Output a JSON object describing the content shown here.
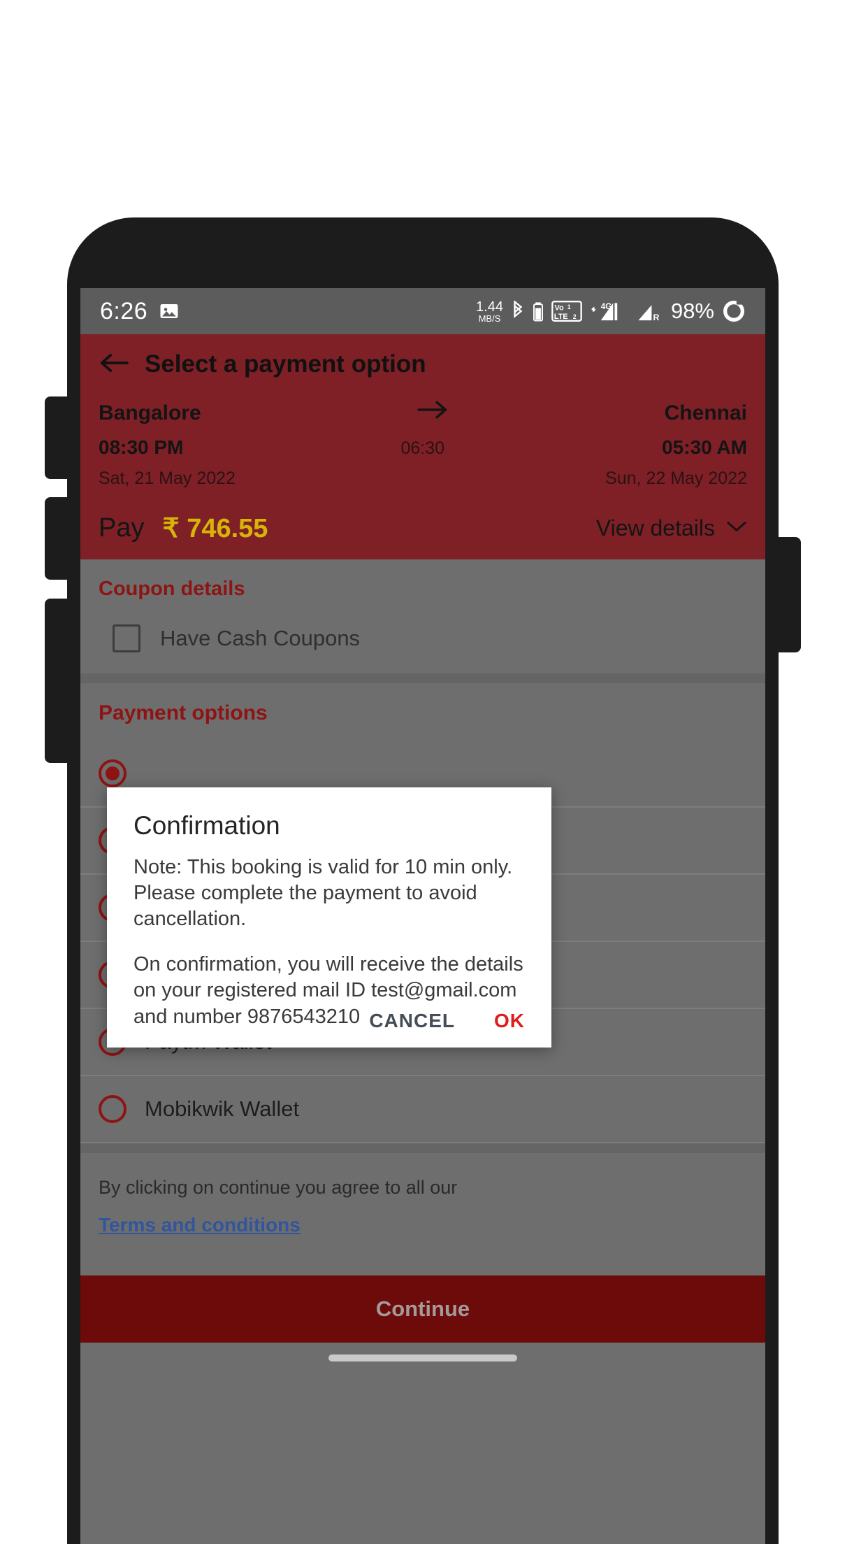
{
  "status_bar": {
    "time": "6:26",
    "screenshot_icon": "image-icon",
    "data_speed_value": "1.44",
    "data_speed_unit": "MB/S",
    "bluetooth_icon": "bluetooth-icon",
    "bluetooth_battery_icon": "bluetooth-battery-icon",
    "volte_icon": "volte-icon",
    "volte_label_top": "Vo",
    "volte_label_bottom": "LTE",
    "sim1_label": "1",
    "sim2_label": "2",
    "network_type": "4G",
    "signal1_icon": "signal-bars-icon",
    "signal2_icon": "signal-bars-roaming-icon",
    "roaming_label": "R",
    "battery_percent": "98%",
    "battery_icon": "battery-ring-icon"
  },
  "header": {
    "back_icon": "arrow-left-icon",
    "title": "Select a payment option",
    "from_city": "Bangalore",
    "to_city": "Chennai",
    "arrow_icon": "arrow-right-icon",
    "depart_time": "08:30 PM",
    "duration": "06:30",
    "arrive_time": "05:30 AM",
    "depart_date": "Sat, 21 May 2022",
    "arrive_date": "Sun, 22 May 2022",
    "pay_label": "Pay",
    "pay_amount": "₹ 746.55",
    "view_details_label": "View details",
    "view_details_icon": "chevron-down-icon",
    "bg_color": "#7e2026",
    "amount_color": "#d6b40a"
  },
  "coupon": {
    "title": "Coupon details",
    "checkbox_label": "Have Cash Coupons",
    "checked": false,
    "title_color": "#8e1414"
  },
  "payment": {
    "title": "Payment options",
    "options": [
      {
        "label": "",
        "selected": true
      },
      {
        "label": "",
        "selected": false
      },
      {
        "label": "",
        "selected": false
      },
      {
        "label": "",
        "selected": false
      },
      {
        "label": "Paytm Wallet",
        "selected": false
      },
      {
        "label": "Mobikwik Wallet",
        "selected": false
      }
    ],
    "accent_color": "#8e1414"
  },
  "terms": {
    "text": "By clicking on continue you agree to all our",
    "link": "Terms and conditions",
    "link_color": "#31569c"
  },
  "footer": {
    "continue_label": "Continue",
    "continue_bg": "#6d0b0b"
  },
  "dialog": {
    "title": "Confirmation",
    "paragraph1": "Note: This booking is valid for 10 min only. Please complete the payment to avoid cancellation.",
    "paragraph2": "On confirmation, you will receive the details on your registered mail ID test@gmail.com and number 9876543210",
    "cancel_label": "CANCEL",
    "ok_label": "OK",
    "ok_color": "#e01b1b",
    "cancel_color": "#454d57"
  }
}
